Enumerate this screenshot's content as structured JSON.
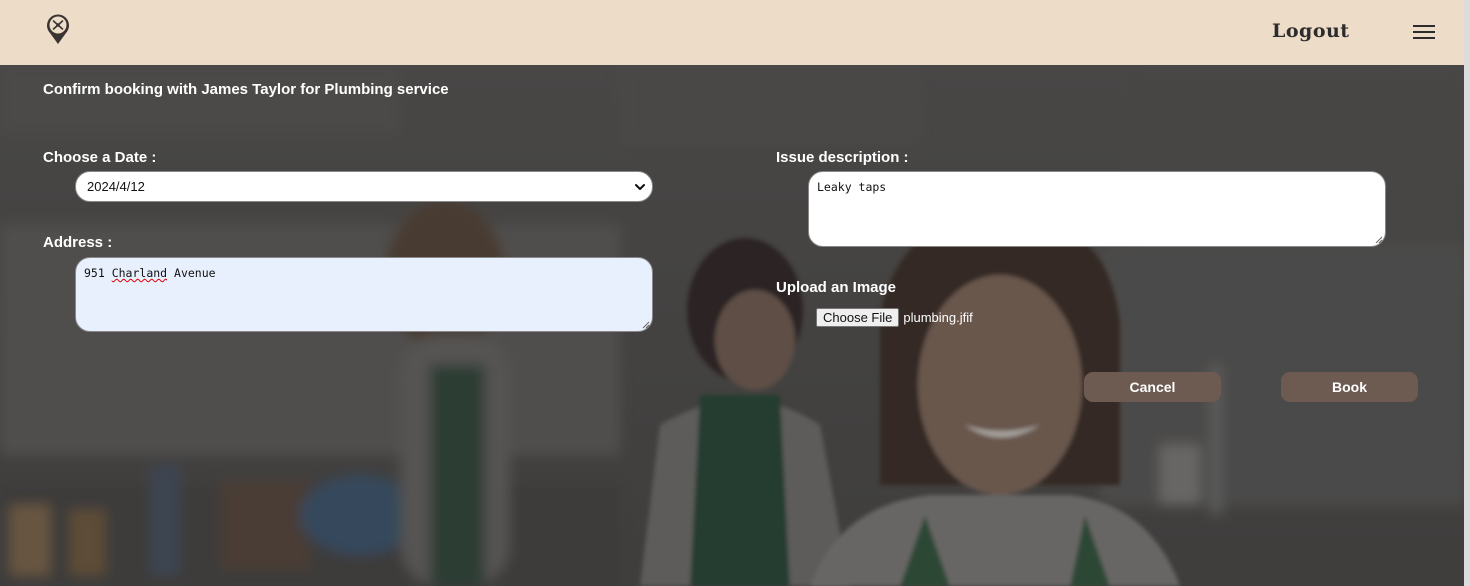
{
  "header": {
    "logo_icon": "location-pin-tools-icon",
    "logout_label": "Logout",
    "menu_icon": "hamburger-menu-icon"
  },
  "form": {
    "title": "Confirm booking with James Taylor for Plumbing service",
    "date_label": "Choose a Date :",
    "date_value": "2024/4/12",
    "address_label": "Address :",
    "address_value_part1": "951 ",
    "address_value_misspelled": "Charland",
    "address_value_part2": " Avenue",
    "issue_label": "Issue description :",
    "issue_value": "Leaky taps",
    "upload_label": "Upload an Image",
    "choose_file_label": "Choose File",
    "file_name": "plumbing.jfif",
    "cancel_label": "Cancel",
    "book_label": "Book"
  },
  "colors": {
    "header_bg": "#ecdcc8",
    "button_bg": "#6d5a50",
    "address_autofill_bg": "#e8f0fe"
  }
}
